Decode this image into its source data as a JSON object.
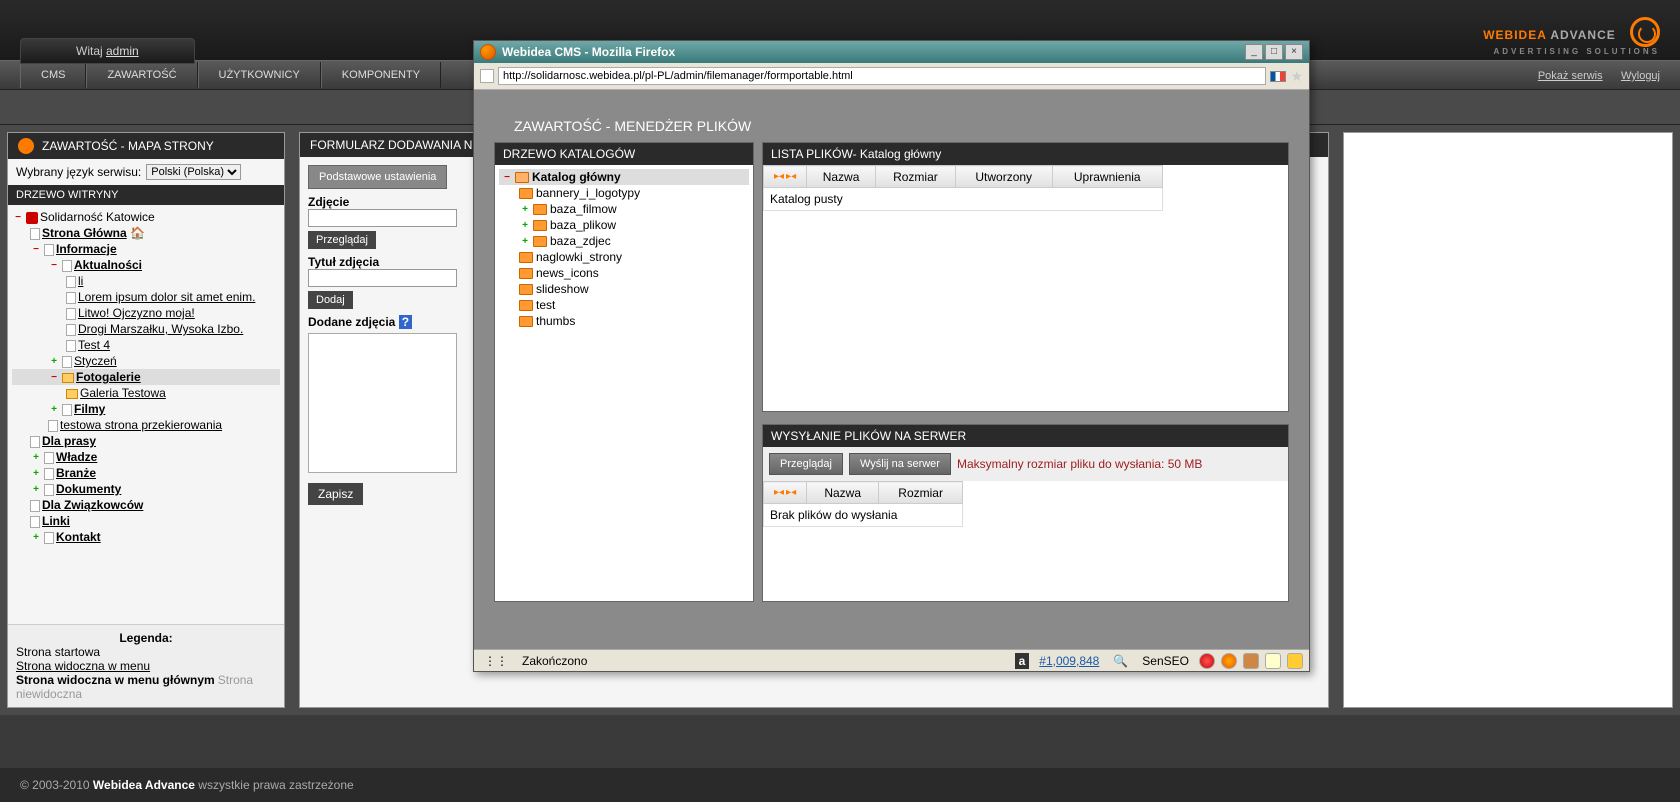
{
  "header": {
    "welcome_prefix": "Witaj ",
    "welcome_user": "admin",
    "logo_main": "WEBIDEA ",
    "logo_sub": "ADVANCE",
    "logo_tag": "ADVERTISING SOLUTIONS"
  },
  "menu": {
    "items": [
      "CMS",
      "ZAWARTOŚĆ",
      "UŻYTKOWNICY",
      "KOMPONENTY"
    ],
    "right": {
      "show_site": "Pokaż serwis",
      "logout": "Wyloguj"
    }
  },
  "left_panel": {
    "title": "ZAWARTOŚĆ - MAPA STRONY",
    "lang_label": "Wybrany język serwisu:",
    "lang_value": "Polski (Polska)",
    "tree_title": "DRZEWO WITRYNY",
    "nodes": {
      "root": "Solidarność Katowice",
      "home": "Strona Główna",
      "info": "Informacje",
      "news": "Aktualności",
      "li": "li",
      "lorem": "Lorem ipsum dolor sit amet enim.",
      "litwo": "Litwo! Ojczyzno moja!",
      "drogi": "Drogi Marszałku, Wysoka Izbo.",
      "test4": "Test 4",
      "styczen": "Styczeń",
      "foto": "Fotogalerie",
      "gal": "Galeria Testowa",
      "filmy": "Filmy",
      "testowa": "testowa strona przekierowania",
      "prasy": "Dla prasy",
      "wladze": "Władze",
      "branze": "Branże",
      "dokumenty": "Dokumenty",
      "zwiazkowcow": "Dla Związkowców",
      "linki": "Linki",
      "kontakt": "Kontakt"
    },
    "legend": {
      "title": "Legenda:",
      "start": "Strona startowa",
      "menu": "Strona widoczna w menu",
      "main_menu": "Strona widoczna w menu głównym",
      "hidden": "Strona niewidoczna"
    }
  },
  "form_panel": {
    "title": "FORMULARZ DODAWANIA N",
    "tab_basic": "Podstawowe ustawienia",
    "label_photo": "Zdjęcie",
    "btn_browse": "Przeglądaj",
    "label_title": "Tytuł zdjęcia",
    "btn_add": "Dodaj",
    "label_added": "Dodane zdjęcia",
    "btn_save": "Zapisz"
  },
  "popup": {
    "win_title": "Webidea CMS - Mozilla Firefox",
    "url": "http://solidarnosc.webidea.pl/pl-PL/admin/filemanager/formportable.html",
    "page_title": "ZAWARTOŚĆ - MENEDŻER PLIKÓW",
    "tree": {
      "header": "DRZEWO KATALOGÓW",
      "root": "Katalog główny",
      "folders": [
        "bannery_i_logotypy",
        "baza_filmow",
        "baza_plikow",
        "baza_zdjec",
        "naglowki_strony",
        "news_icons",
        "slideshow",
        "test",
        "thumbs"
      ]
    },
    "files": {
      "header": "LISTA PLIKÓW- Katalog główny",
      "cols": {
        "name": "Nazwa",
        "size": "Rozmiar",
        "created": "Utworzony",
        "perms": "Uprawnienia"
      },
      "empty": "Katalog pusty"
    },
    "upload": {
      "header": "WYSYŁANIE PLIKÓW NA SERWER",
      "browse": "Przeglądaj",
      "send": "Wyślij na serwer",
      "max": "Maksymalny rozmiar pliku do wysłania: 50 MB",
      "cols": {
        "name": "Nazwa",
        "size": "Rozmiar"
      },
      "empty": "Brak plików do wysłania"
    },
    "status": {
      "done": "Zakończono",
      "count": "#1,009,848",
      "senseo": "SenSEO"
    }
  },
  "footer": {
    "copyright_prefix": "© 2003-2010 ",
    "brand": "Webidea Advance",
    "suffix": " wszystkie prawa zastrzeżone"
  }
}
